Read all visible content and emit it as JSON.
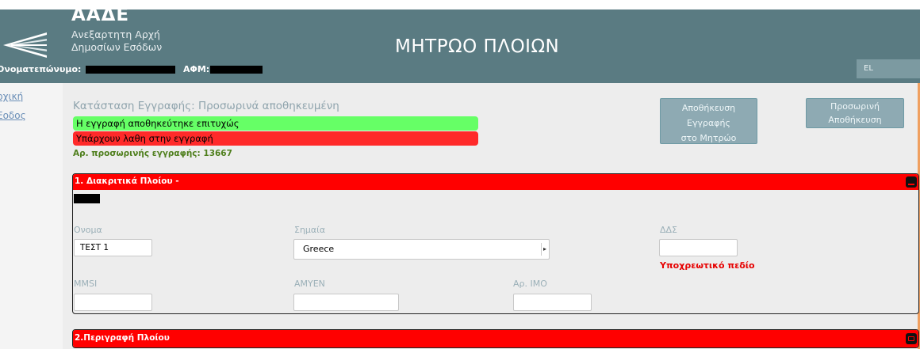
{
  "header": {
    "logo_title": "ΑΑΔΕ",
    "logo_sub1": "Ανεξαρτητη Αρχή",
    "logo_sub2": "Δημοσίων Εσόδων",
    "app_title": "ΜΗΤΡΩΟ ΠΛΟΙΩΝ",
    "user_label": "Ονοματεπώνυμο:",
    "afm_label": "ΑΦΜ:",
    "lang": "EL"
  },
  "sidebar": {
    "items": [
      {
        "label": "ρχική"
      },
      {
        "label": "Εοδος"
      }
    ]
  },
  "status": {
    "label": "Κατάσταση Εγγραφής:  Προσωρινά αποθηκευμένη",
    "success_msg": "Η εγγραφή αποθηκεύτηκε επιτυχώς",
    "error_msg": "Υπάρχουν λαθη στην εγγραφή",
    "temp_number": "Αρ. προσωρινής εγγραφής: 13667"
  },
  "actions": {
    "save_line1": "Αποθήκευση",
    "save_line2": "Εγγραφής",
    "save_line3": "στο Μητρώο",
    "temp_line1": "Προσωρινή",
    "temp_line2": "Αποθήκευση"
  },
  "section1": {
    "title": "1. Διακριτικά Πλοίου -",
    "name_label": "Ονομα",
    "name_value": "ΤΕΣΤ 1",
    "flag_label": "Σημαία",
    "flag_value": "Greece",
    "dds_label": "ΔΔΣ",
    "dds_value": "",
    "dds_required": "Υποχρεωτικό πεδίο",
    "mmsi_label": "MMSI",
    "mmsi_value": "",
    "amyen_label": "ΑΜΥΕΝ",
    "amyen_value": "",
    "imo_label": "Αρ. ΙΜΟ",
    "imo_value": ""
  },
  "section2": {
    "title": "2.Περιγραφή Πλοίου"
  },
  "colors": {
    "header_bg": "#5a7b82",
    "error_red": "#ff0000",
    "success_green": "#66ff66",
    "button_bg": "#8eaab3"
  },
  "icons": [
    "aade-logo-icon",
    "collapse-icon",
    "expand-icon",
    "select-arrow-icon"
  ]
}
